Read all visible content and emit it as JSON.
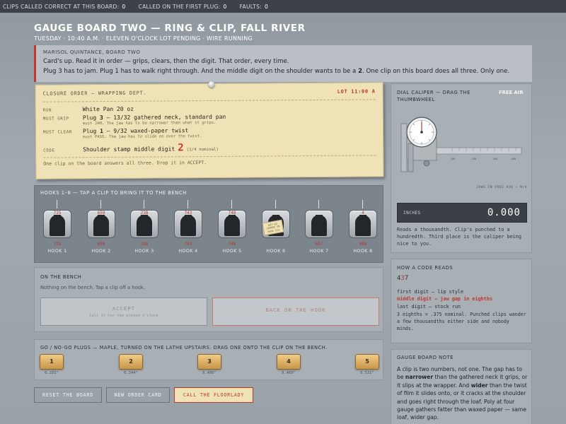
{
  "status": {
    "correct_label": "Clips called correct at this board:",
    "correct_count": "0",
    "first_plug_label": "Called on the first plug:",
    "first_plug_count": "0",
    "faults_label": "Faults:",
    "faults_count": "0"
  },
  "header": {
    "title": "Gauge Board Two — Ring & Clip, Fall River",
    "subtitle": "Tuesday · 10:40 A.M. · Eleven O'Clock Lot Pending · Wire Running"
  },
  "dialogue": {
    "speaker": "Marisol Quintance, Board Two",
    "line1": "Card's up. Read it in order — grips, clears, then the digit. That order, every time.",
    "line2_pre": "Plug 3 has to jam. Plug 1 has to walk right through. And the middle digit on the shoulder wants to be a",
    "line2_digit": "2",
    "line2_post": ". One clip on this board does all three. Only one."
  },
  "order_card": {
    "heading": "Closure Order — Wrapping Dept.",
    "lot": "Lot 11:00 A",
    "run_label": "Run",
    "run_value": "White Pan 20 oz",
    "grip_label": "Must Grip",
    "grip_plug_word": "Plug",
    "grip_plug_num": "3",
    "grip_value": "— 13/32 gathered neck, standard pan",
    "grip_sub": "must JAM. The jaw has to be narrower than what it grips.",
    "clear_label": "Must Clear",
    "clear_plug_word": "Plug",
    "clear_plug_num": "1",
    "clear_value": "— 9/32 waxed-paper twist",
    "clear_sub": "must PASS. The jaw has to slide on over the twist.",
    "code_label": "Code",
    "code_value": "Shoulder stamp middle digit",
    "code_digit": "2",
    "code_nominal": "(1/4 nominal)",
    "footer": "One clip on the board answers all three. Drop it in ACCEPT."
  },
  "hooks": {
    "title": "Hooks 1–8 — tap a clip to bring it to the bench",
    "items": [
      {
        "label": "Hook 1",
        "top": "725",
        "code": "725"
      },
      {
        "label": "Hook 2",
        "top": "659",
        "code": "659"
      },
      {
        "label": "Hook 3",
        "top": "238",
        "code": "238"
      },
      {
        "label": "Hook 4",
        "top": "743",
        "code": "743"
      },
      {
        "label": "Hook 5",
        "top": "748",
        "code": "748"
      },
      {
        "label": "Hook 6",
        "top": "",
        "code": "",
        "tag": "Out-Go Jammed on Hook Six"
      },
      {
        "label": "Hook 7",
        "top": "",
        "code": "657"
      },
      {
        "label": "Hook 8",
        "top": "4",
        "code": "469"
      }
    ]
  },
  "bench": {
    "title": "On the Bench",
    "hint": "Nothing on the bench. Tap a clip off a hook.",
    "accept_label": "Accept",
    "accept_sub": "Call it for the eleven o'clock",
    "back_label": "Back on the Hook"
  },
  "plugs": {
    "title": "Go / No-Go Plugs — maple, turned on the lathe upstairs. Drag one onto the clip on the bench.",
    "items": [
      {
        "num": "1",
        "dia": "0.281\""
      },
      {
        "num": "2",
        "dia": "0.344\""
      },
      {
        "num": "3",
        "dia": "0.406\""
      },
      {
        "num": "4",
        "dia": "0.469\""
      },
      {
        "num": "5",
        "dia": "0.531\""
      }
    ]
  },
  "footer_buttons": {
    "reset": "Reset the Board",
    "new_order": "New Order Card",
    "floorlady": "Call the Floorlady"
  },
  "caliper": {
    "title": "Dial Caliper — drag the thumbwheel",
    "free_air": "Free Air",
    "jaws": "Jaws in free air — n/a",
    "unit": "Inches",
    "reading": "0.000",
    "note": "Reads a thousandth. Clip's punched to a hundredth. Third place is the caliper being nice to you."
  },
  "code_guide": {
    "title": "How a code reads",
    "example_a": "4",
    "example_b": "3",
    "example_c": "7",
    "first": "first digit — lip style",
    "middle": "middle digit — jaw gap in eighths",
    "last": "last digit — stock run",
    "desc": "3 eighths = .375 nominal. Punched clips wander a few thousandths either side and nobody minds."
  },
  "board_note": {
    "title": "Gauge Board Note",
    "p1": "A clip is two numbers, not one. The gap has to be",
    "w1": "narrower",
    "p2": "than the gathered neck it grips, or it slips at the wrapper. And",
    "w2": "wider",
    "p3": "than the twist of film it slides onto, or it cracks at the shoulder and goes right through the loaf. Poly at four gauge gathers fatter than waxed paper — same loaf, wider gap."
  },
  "colors": {
    "accent_red": "#c0392b",
    "card_paper": "#efe2b7",
    "maple": "#e3b46a"
  }
}
